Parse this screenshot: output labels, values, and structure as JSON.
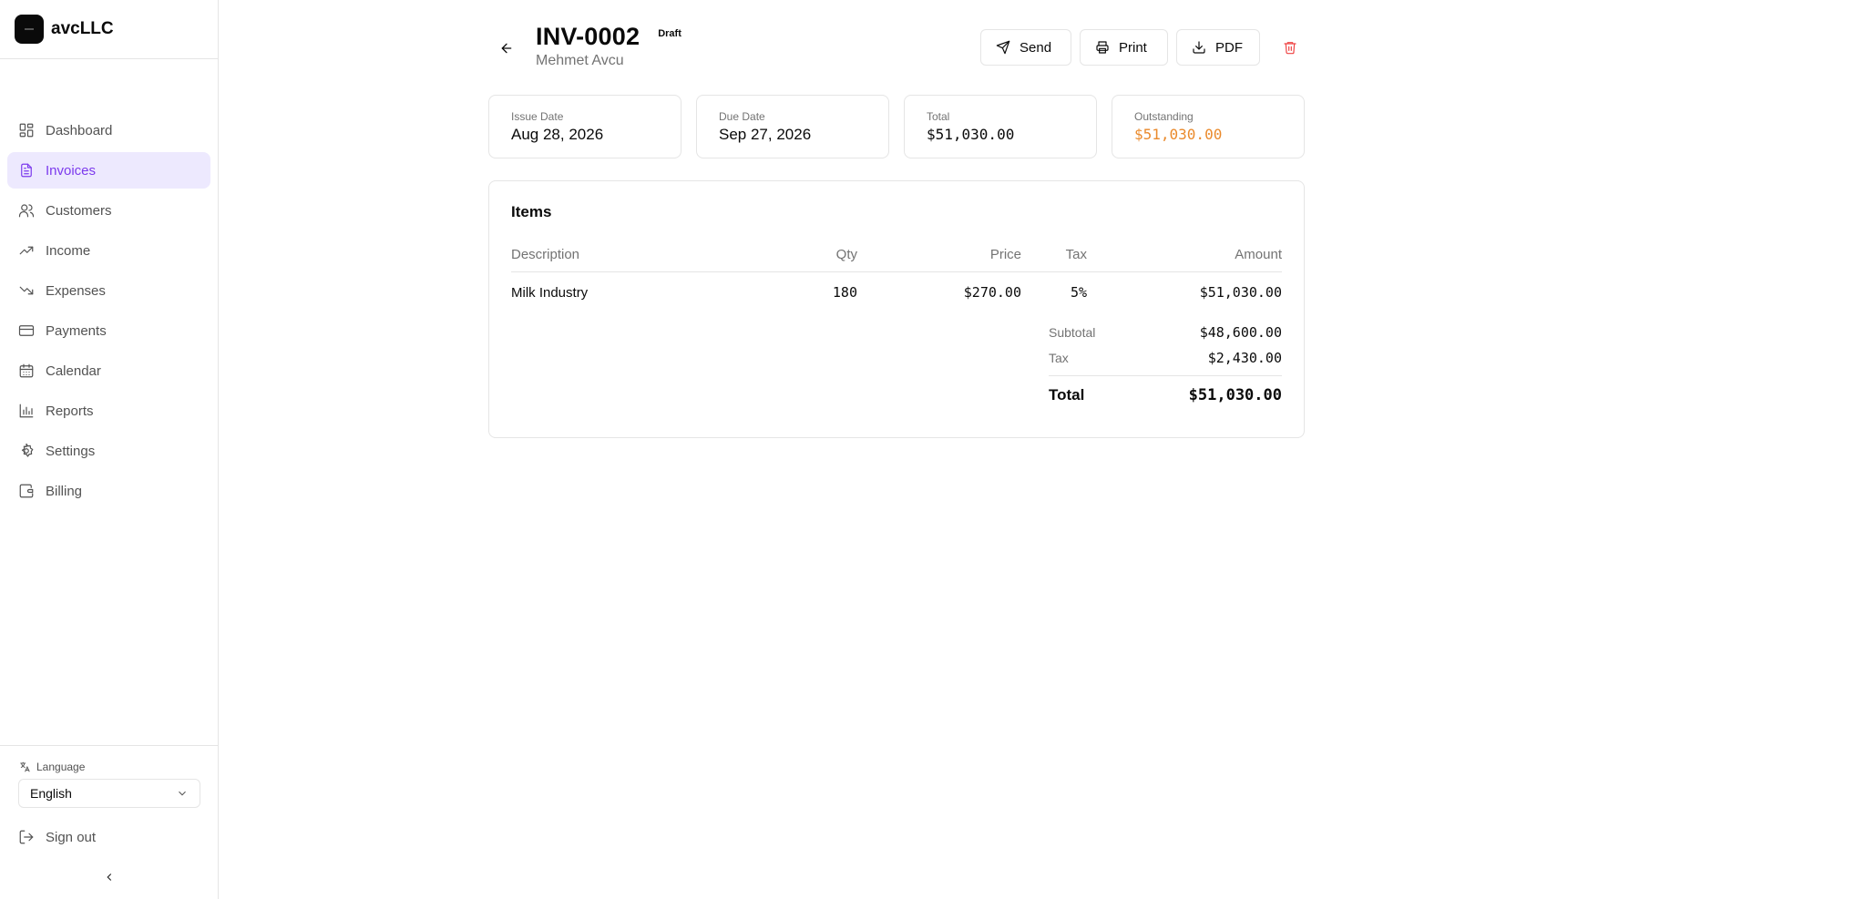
{
  "brand": {
    "name": "avcLLC"
  },
  "sidebar": {
    "items": [
      {
        "label": "Dashboard",
        "icon": "dashboard-icon",
        "active": false
      },
      {
        "label": "Invoices",
        "icon": "invoice-icon",
        "active": true
      },
      {
        "label": "Customers",
        "icon": "users-icon",
        "active": false
      },
      {
        "label": "Income",
        "icon": "trending-up-icon",
        "active": false
      },
      {
        "label": "Expenses",
        "icon": "trending-down-icon",
        "active": false
      },
      {
        "label": "Payments",
        "icon": "credit-card-icon",
        "active": false
      },
      {
        "label": "Calendar",
        "icon": "calendar-icon",
        "active": false
      },
      {
        "label": "Reports",
        "icon": "bar-chart-icon",
        "active": false
      },
      {
        "label": "Settings",
        "icon": "gear-icon",
        "active": false
      },
      {
        "label": "Billing",
        "icon": "wallet-icon",
        "active": false
      }
    ],
    "language_label": "Language",
    "language_value": "English",
    "signout_label": "Sign out"
  },
  "invoice": {
    "number": "INV-0002",
    "status": "Draft",
    "customer": "Mehmet Avcu"
  },
  "actions": {
    "send": "Send",
    "print": "Print",
    "pdf": "PDF"
  },
  "stats": {
    "issue_label": "Issue Date",
    "issue_value": "Aug 28, 2026",
    "due_label": "Due Date",
    "due_value": "Sep 27, 2026",
    "total_label": "Total",
    "total_value": "$51,030.00",
    "outstanding_label": "Outstanding",
    "outstanding_value": "$51,030.00"
  },
  "items": {
    "title": "Items",
    "columns": {
      "description": "Description",
      "qty": "Qty",
      "price": "Price",
      "tax": "Tax",
      "amount": "Amount"
    },
    "rows": [
      {
        "description": "Milk Industry",
        "qty": "180",
        "price": "$270.00",
        "tax": "5%",
        "amount": "$51,030.00"
      }
    ],
    "subtotal_label": "Subtotal",
    "subtotal_value": "$48,600.00",
    "tax_label": "Tax",
    "tax_value": "$2,430.00",
    "total_label": "Total",
    "total_value": "$51,030.00"
  },
  "colors": {
    "accent": "#7c3aed",
    "accent_bg": "#ede9fe",
    "warning": "#ea8a2c",
    "danger": "#ef4444"
  }
}
